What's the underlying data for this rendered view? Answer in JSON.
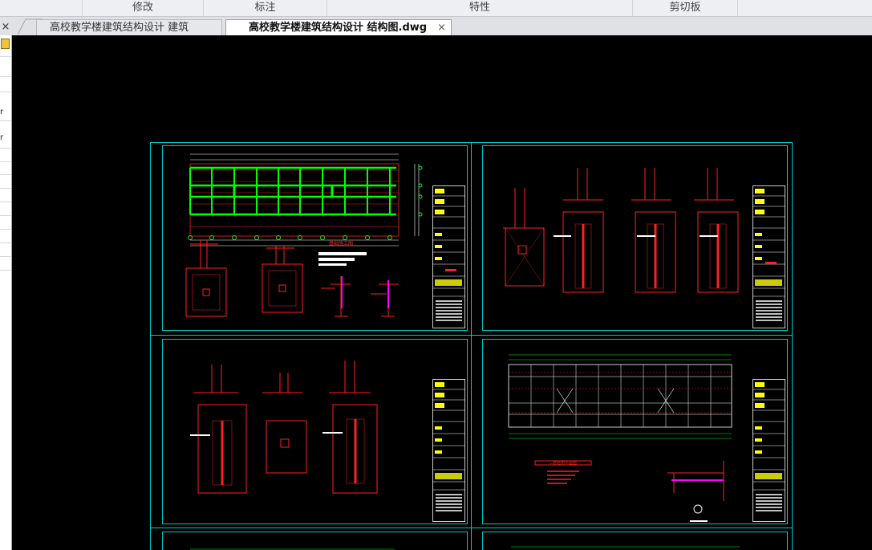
{
  "ribbon": {
    "panels": [
      "修改",
      "标注",
      "特性",
      "剪切板"
    ]
  },
  "tabs": [
    {
      "label": "高校教学楼建筑结构设计 建筑图.dwg",
      "active": false
    },
    {
      "label": "高校教学楼建筑结构设计 结构图.dwg",
      "active": true
    }
  ],
  "tab_close_glyph": "×",
  "left_close_glyph": "×",
  "palette_letters": [
    "r",
    "r"
  ],
  "drawing": {
    "labels": {
      "foundation_plan": "基础施工图",
      "second_floor_plan": "二层结构平面图"
    }
  },
  "colors": {
    "ribbon_bg": "#eeeff2",
    "canvas_bg": "#000000",
    "frame": "#00c8c8",
    "lines_red": "#ff2020",
    "lines_green": "#00ff00",
    "lines_yellow": "#ffff00",
    "lines_white": "#ffffff",
    "lines_magenta": "#ff00ff"
  }
}
